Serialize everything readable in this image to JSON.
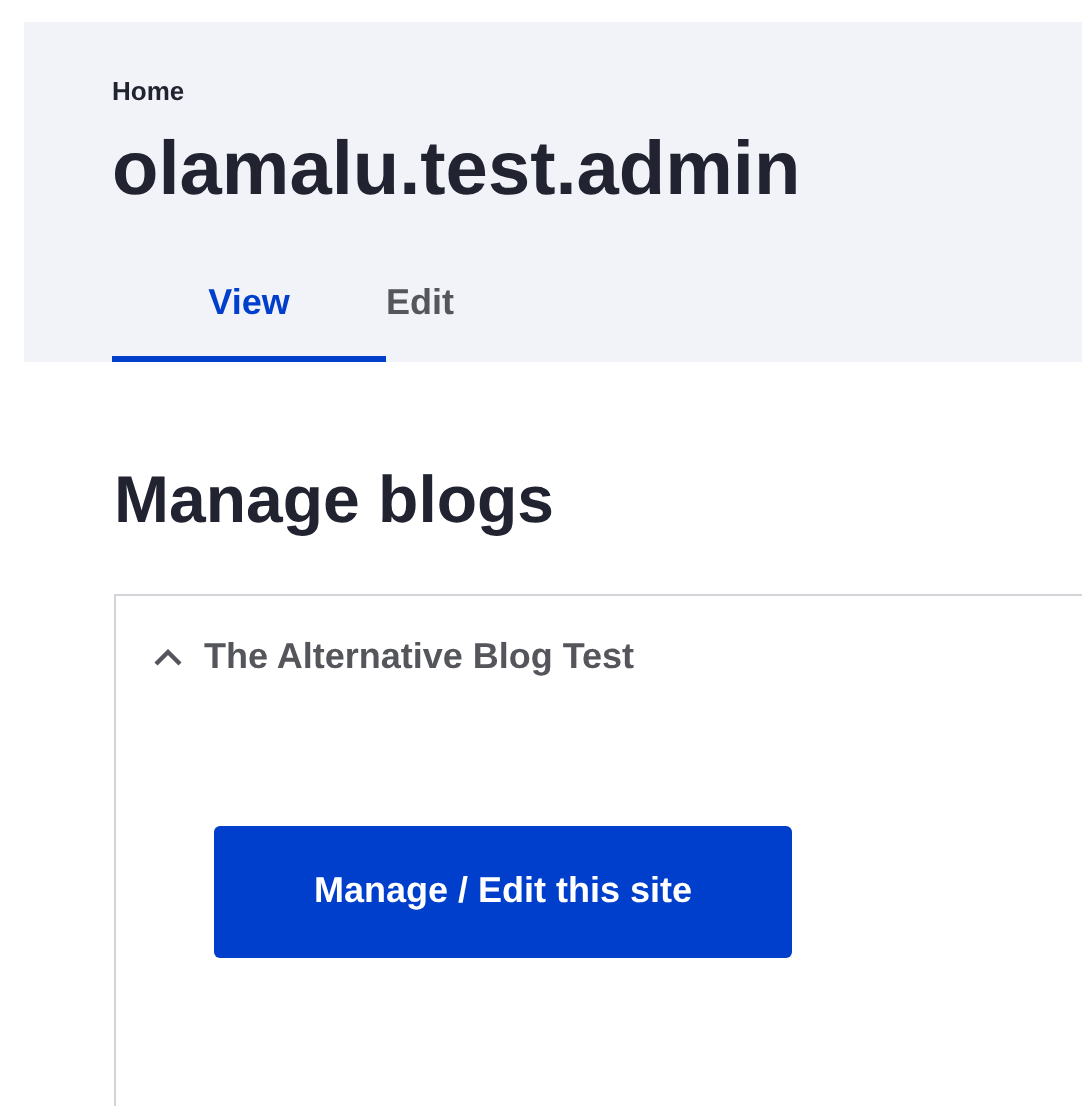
{
  "breadcrumb": [
    "Home"
  ],
  "page_title": "olamalu.test.admin",
  "tabs": [
    {
      "label": "View",
      "selected": true
    },
    {
      "label": "Edit",
      "selected": false
    }
  ],
  "section_title": "Manage blogs",
  "blogs": [
    {
      "title": "The Alternative Blog Test",
      "expanded": true,
      "button": "Manage / Edit this site"
    }
  ]
}
